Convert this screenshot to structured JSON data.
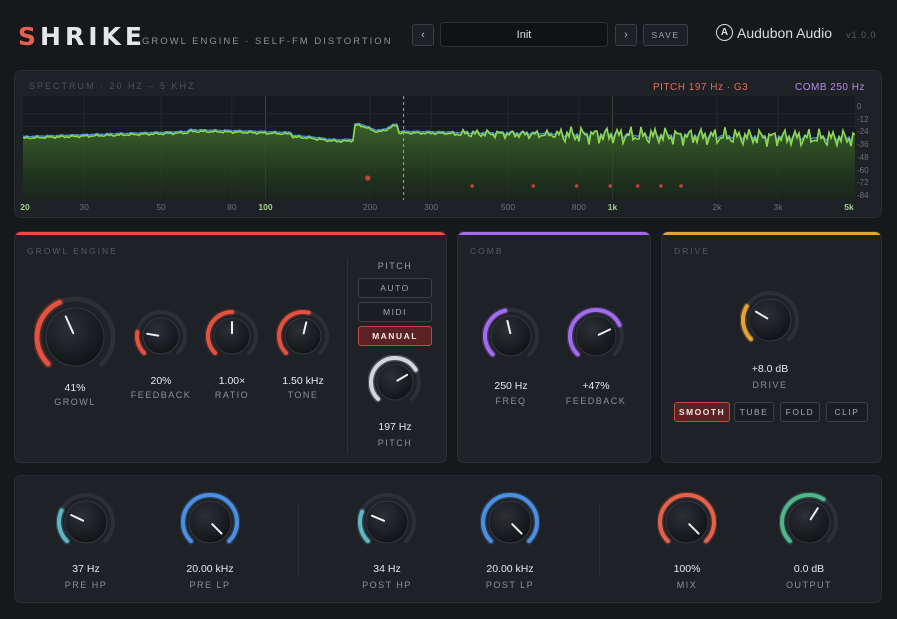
{
  "header": {
    "logo_first": "S",
    "logo_rest": "HRIKE",
    "subtitle": "GROWL ENGINE · SELF-FM DISTORTION",
    "prev_label": "‹",
    "next_label": "›",
    "preset": "Init",
    "save_label": "SAVE",
    "brand_icon": "A",
    "brand": "Audubon Audio",
    "version": "v1.0.0"
  },
  "spectrum": {
    "label": "SPECTRUM · 20 HZ – 5 KHZ",
    "pitch_readout": "PITCH 197 Hz · G3",
    "comb_readout": "COMB 250 Hz",
    "db_ticks": [
      "0",
      "-12",
      "-24",
      "-36",
      "-48",
      "-60",
      "-72",
      "-84"
    ],
    "hz_ticks": [
      {
        "label": "20",
        "major": true
      },
      {
        "label": "30",
        "major": false
      },
      {
        "label": "50",
        "major": false
      },
      {
        "label": "80",
        "major": false
      },
      {
        "label": "100",
        "major": true
      },
      {
        "label": "200",
        "major": false
      },
      {
        "label": "300",
        "major": false
      },
      {
        "label": "500",
        "major": false
      },
      {
        "label": "800",
        "major": false
      },
      {
        "label": "1k",
        "major": true
      },
      {
        "label": "2k",
        "major": false
      },
      {
        "label": "3k",
        "major": false
      },
      {
        "label": "5k",
        "major": true
      }
    ],
    "colors": {
      "green": "#8fd84e",
      "blue": "#4a8fd8",
      "pitch": "#e56a55",
      "comb": "#b48aec"
    }
  },
  "growl": {
    "title": "GROWL ENGINE",
    "color": "#e5503f",
    "knobs": [
      {
        "name": "growl",
        "value": "41%",
        "label": "GROWL",
        "level": 0.41
      },
      {
        "name": "feedback",
        "value": "20%",
        "label": "FEEDBACK",
        "level": 0.2
      },
      {
        "name": "ratio",
        "value": "1.00×",
        "label": "RATIO",
        "level": 0.5
      },
      {
        "name": "tone",
        "value": "1.50 kHz",
        "label": "TONE",
        "level": 0.55
      }
    ],
    "pitch": {
      "heading": "PITCH",
      "modes": [
        "AUTO",
        "MIDI",
        "MANUAL"
      ],
      "active_mode": "MANUAL",
      "value": "197 Hz",
      "label": "PITCH",
      "level": 0.72
    }
  },
  "comb": {
    "title": "COMB",
    "color": "#a46bf2",
    "knobs": [
      {
        "name": "freq",
        "value": "250 Hz",
        "label": "FREQ",
        "level": 0.45
      },
      {
        "name": "comb-feedback",
        "value": "+47%",
        "label": "FEEDBACK",
        "level": 0.74
      }
    ]
  },
  "drive": {
    "title": "DRIVE",
    "color": "#e8a23a",
    "knob": {
      "name": "drive",
      "value": "+8.0 dB",
      "label": "DRIVE",
      "level": 0.28
    },
    "modes": [
      "SMOOTH",
      "TUBE",
      "FOLD",
      "CLIP"
    ],
    "active_mode": "SMOOTH"
  },
  "io": {
    "knobs": [
      {
        "name": "pre-hp",
        "value": "37 Hz",
        "label": "PRE HP",
        "level": 0.26,
        "color": "#5fb7c4"
      },
      {
        "name": "pre-lp",
        "value": "20.00 kHz",
        "label": "PRE LP",
        "level": 1.0,
        "color": "#4b8fe2"
      },
      {
        "name": "post-hp",
        "value": "34 Hz",
        "label": "POST HP",
        "level": 0.25,
        "color": "#5fb7c4"
      },
      {
        "name": "post-lp",
        "value": "20.00 kHz",
        "label": "POST LP",
        "level": 1.0,
        "color": "#4b8fe2"
      },
      {
        "name": "mix",
        "value": "100%",
        "label": "MIX",
        "level": 1.0,
        "color": "#e5614a"
      },
      {
        "name": "output",
        "value": "0.0 dB",
        "label": "OUTPUT",
        "level": 0.62,
        "color": "#4fb58a"
      }
    ]
  }
}
